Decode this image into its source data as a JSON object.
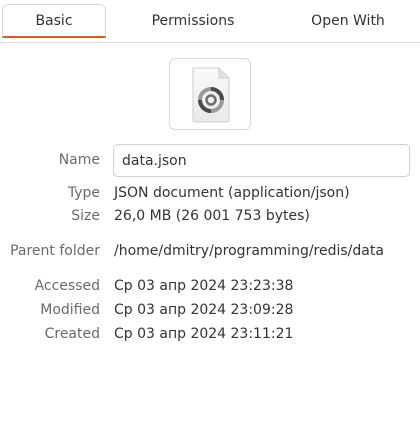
{
  "tabs": [
    {
      "label": "Basic",
      "active": true
    },
    {
      "label": "Permissions",
      "active": false
    },
    {
      "label": "Open With",
      "active": false
    }
  ],
  "file_icon": {
    "name": "json-file-icon",
    "accent": "#e95420"
  },
  "name": {
    "label": "Name",
    "value": "data.json"
  },
  "type": {
    "label": "Type",
    "value": "JSON document (application/json)"
  },
  "size": {
    "label": "Size",
    "value": "26,0 MB (26 001 753 bytes)"
  },
  "parent": {
    "label": "Parent folder",
    "value": "/home/dmitry/programming/redis/data"
  },
  "accessed": {
    "label": "Accessed",
    "value": "Ср 03 апр 2024 23:23:38"
  },
  "modified": {
    "label": "Modified",
    "value": "Ср 03 апр 2024 23:09:28"
  },
  "created": {
    "label": "Created",
    "value": "Ср 03 апр 2024 23:11:21"
  }
}
